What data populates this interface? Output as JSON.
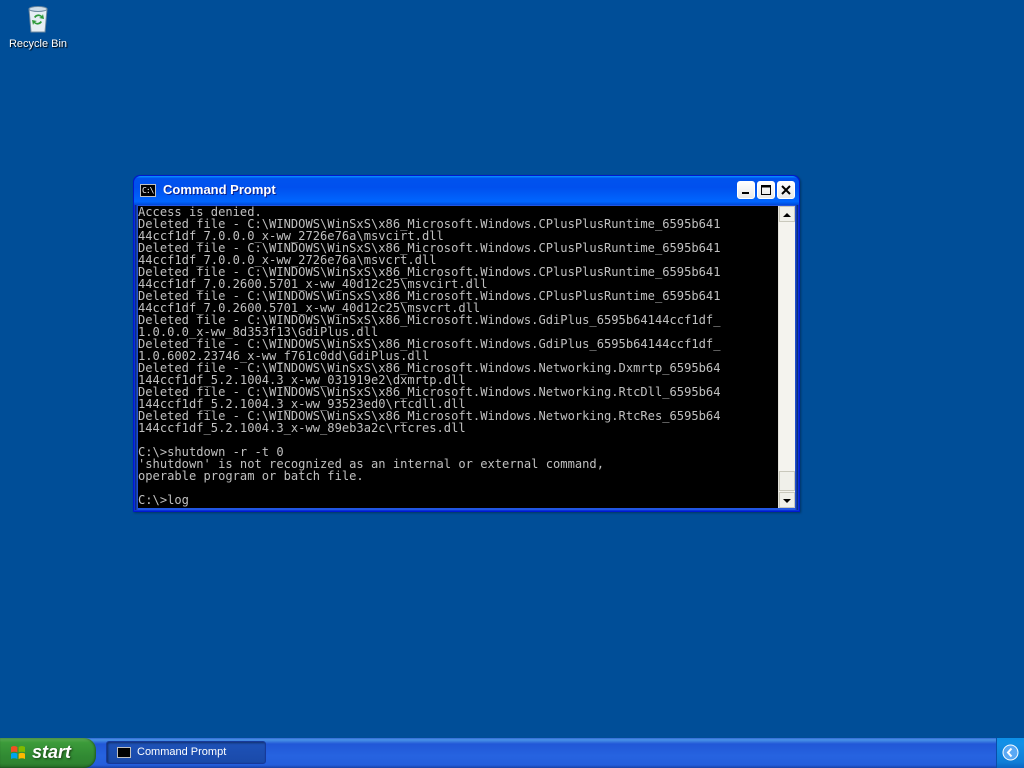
{
  "desktop": {
    "icons": [
      {
        "label": "Recycle Bin",
        "icon": "recycle-bin-icon"
      }
    ]
  },
  "window": {
    "title": "Command Prompt",
    "icon": "console-icon",
    "buttons": {
      "minimize": "minimize-icon",
      "maximize": "maximize-icon",
      "close": "close-icon"
    },
    "console_lines": [
      "Access is denied.",
      "Deleted file - C:\\WINDOWS\\WinSxS\\x86_Microsoft.Windows.CPlusPlusRuntime_6595b641",
      "44ccf1df_7.0.0.0_x-ww_2726e76a\\msvcirt.dll",
      "Deleted file - C:\\WINDOWS\\WinSxS\\x86_Microsoft.Windows.CPlusPlusRuntime_6595b641",
      "44ccf1df_7.0.0.0_x-ww_2726e76a\\msvcrt.dll",
      "Deleted file - C:\\WINDOWS\\WinSxS\\x86_Microsoft.Windows.CPlusPlusRuntime_6595b641",
      "44ccf1df_7.0.2600.5701_x-ww_40d12c25\\msvcirt.dll",
      "Deleted file - C:\\WINDOWS\\WinSxS\\x86_Microsoft.Windows.CPlusPlusRuntime_6595b641",
      "44ccf1df_7.0.2600.5701_x-ww_40d12c25\\msvcrt.dll",
      "Deleted file - C:\\WINDOWS\\WinSxS\\x86_Microsoft.Windows.GdiPlus_6595b64144ccf1df_",
      "1.0.0.0_x-ww_8d353f13\\GdiPlus.dll",
      "Deleted file - C:\\WINDOWS\\WinSxS\\x86_Microsoft.Windows.GdiPlus_6595b64144ccf1df_",
      "1.0.6002.23746_x-ww_f761c0dd\\GdiPlus.dll",
      "Deleted file - C:\\WINDOWS\\WinSxS\\x86_Microsoft.Windows.Networking.Dxmrtp_6595b64",
      "144ccf1df_5.2.1004.3_x-ww_031919e2\\dxmrtp.dll",
      "Deleted file - C:\\WINDOWS\\WinSxS\\x86_Microsoft.Windows.Networking.RtcDll_6595b64",
      "144ccf1df_5.2.1004.3_x-ww_93523ed0\\rtcdll.dll",
      "Deleted file - C:\\WINDOWS\\WinSxS\\x86_Microsoft.Windows.Networking.RtcRes_6595b64",
      "144ccf1df_5.2.1004.3_x-ww_89eb3a2c\\rtcres.dll",
      "",
      "C:\\>shutdown -r -t 0",
      "'shutdown' is not recognized as an internal or external command,",
      "operable program or batch file.",
      "",
      "C:\\>log"
    ]
  },
  "taskbar": {
    "start_label": "start",
    "start_icon": "windows-logo-icon",
    "tasks": [
      {
        "label": "Command Prompt",
        "icon": "console-icon"
      }
    ],
    "tray_icon": "tray-chevron-icon"
  },
  "colors": {
    "desktop_bg": "#004e98",
    "titlebar_blue": "#0058ee",
    "console_bg": "#000000",
    "console_text": "#c0c0c0",
    "start_green": "#3c9b3a",
    "close_red": "#c9421f"
  }
}
